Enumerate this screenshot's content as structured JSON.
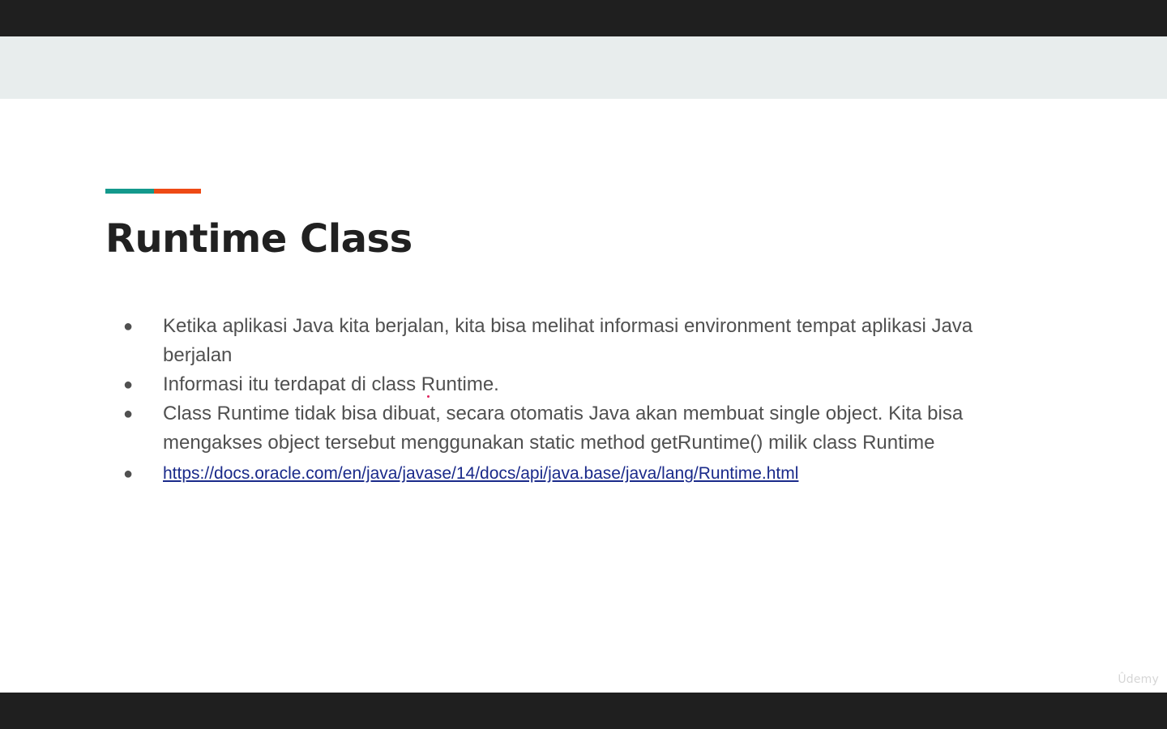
{
  "slide": {
    "title": "Runtime Class",
    "bullets": [
      "Ketika aplikasi Java kita berjalan, kita bisa melihat informasi environment tempat aplikasi Java berjalan",
      "Informasi itu terdapat di class Runtime.",
      "Class Runtime tidak bisa dibuat, secara otomatis Java akan membuat single object. Kita bisa mengakses  object  tersebut menggunakan static method getRuntime() milik class Runtime"
    ],
    "link": "https://docs.oracle.com/en/java/javase/14/docs/api/java.base/java/lang/Runtime.html",
    "bullet_glyph": "●"
  },
  "watermark": "Ûdemy",
  "colors": {
    "accent_teal": "#13998c",
    "accent_orange": "#ee4a15",
    "laser": "#e0245e"
  }
}
